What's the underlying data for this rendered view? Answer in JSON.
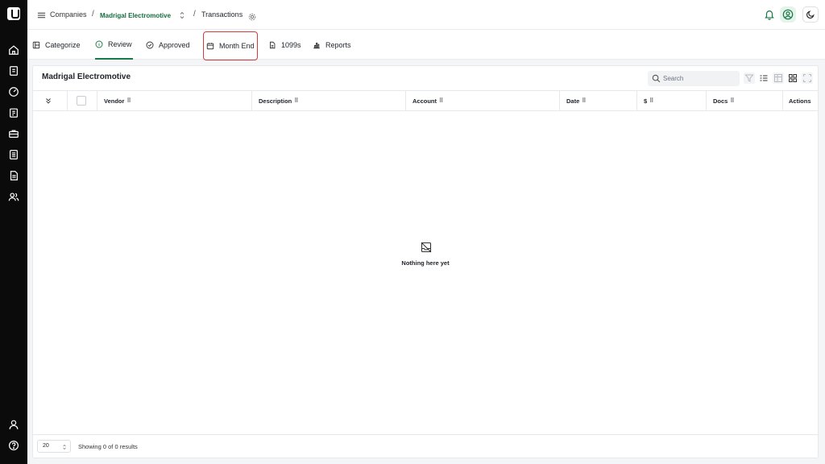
{
  "breadcrumb": {
    "companies": "Companies",
    "separator": "/",
    "company": "Madrigal Electromotive",
    "page": "Transactions"
  },
  "tabs": [
    {
      "label": "Categorize",
      "icon": "categorize-icon",
      "active": false
    },
    {
      "label": "Review",
      "icon": "info-circle-icon",
      "active": true
    },
    {
      "label": "Approved",
      "icon": "check-circle-icon",
      "active": false
    },
    {
      "label": "Month End",
      "icon": "calendar-icon",
      "active": false,
      "highlighted": true
    },
    {
      "label": "1099s",
      "icon": "document-icon",
      "active": false
    },
    {
      "label": "Reports",
      "icon": "bar-chart-icon",
      "active": false
    }
  ],
  "card": {
    "title": "Madrigal Electromotive",
    "search_placeholder": "Search"
  },
  "table": {
    "columns": [
      "Vendor",
      "Description",
      "Account",
      "Date",
      "$",
      "Docs",
      "Actions"
    ],
    "drag_glyph": "⠿",
    "empty_text": "Nothing here yet"
  },
  "footer": {
    "page_size": "20",
    "results": "Showing 0 of 0 results"
  },
  "colors": {
    "accent": "#1a7a47",
    "sidebar": "#0b0b0b",
    "highlight": "#d33b3b"
  }
}
